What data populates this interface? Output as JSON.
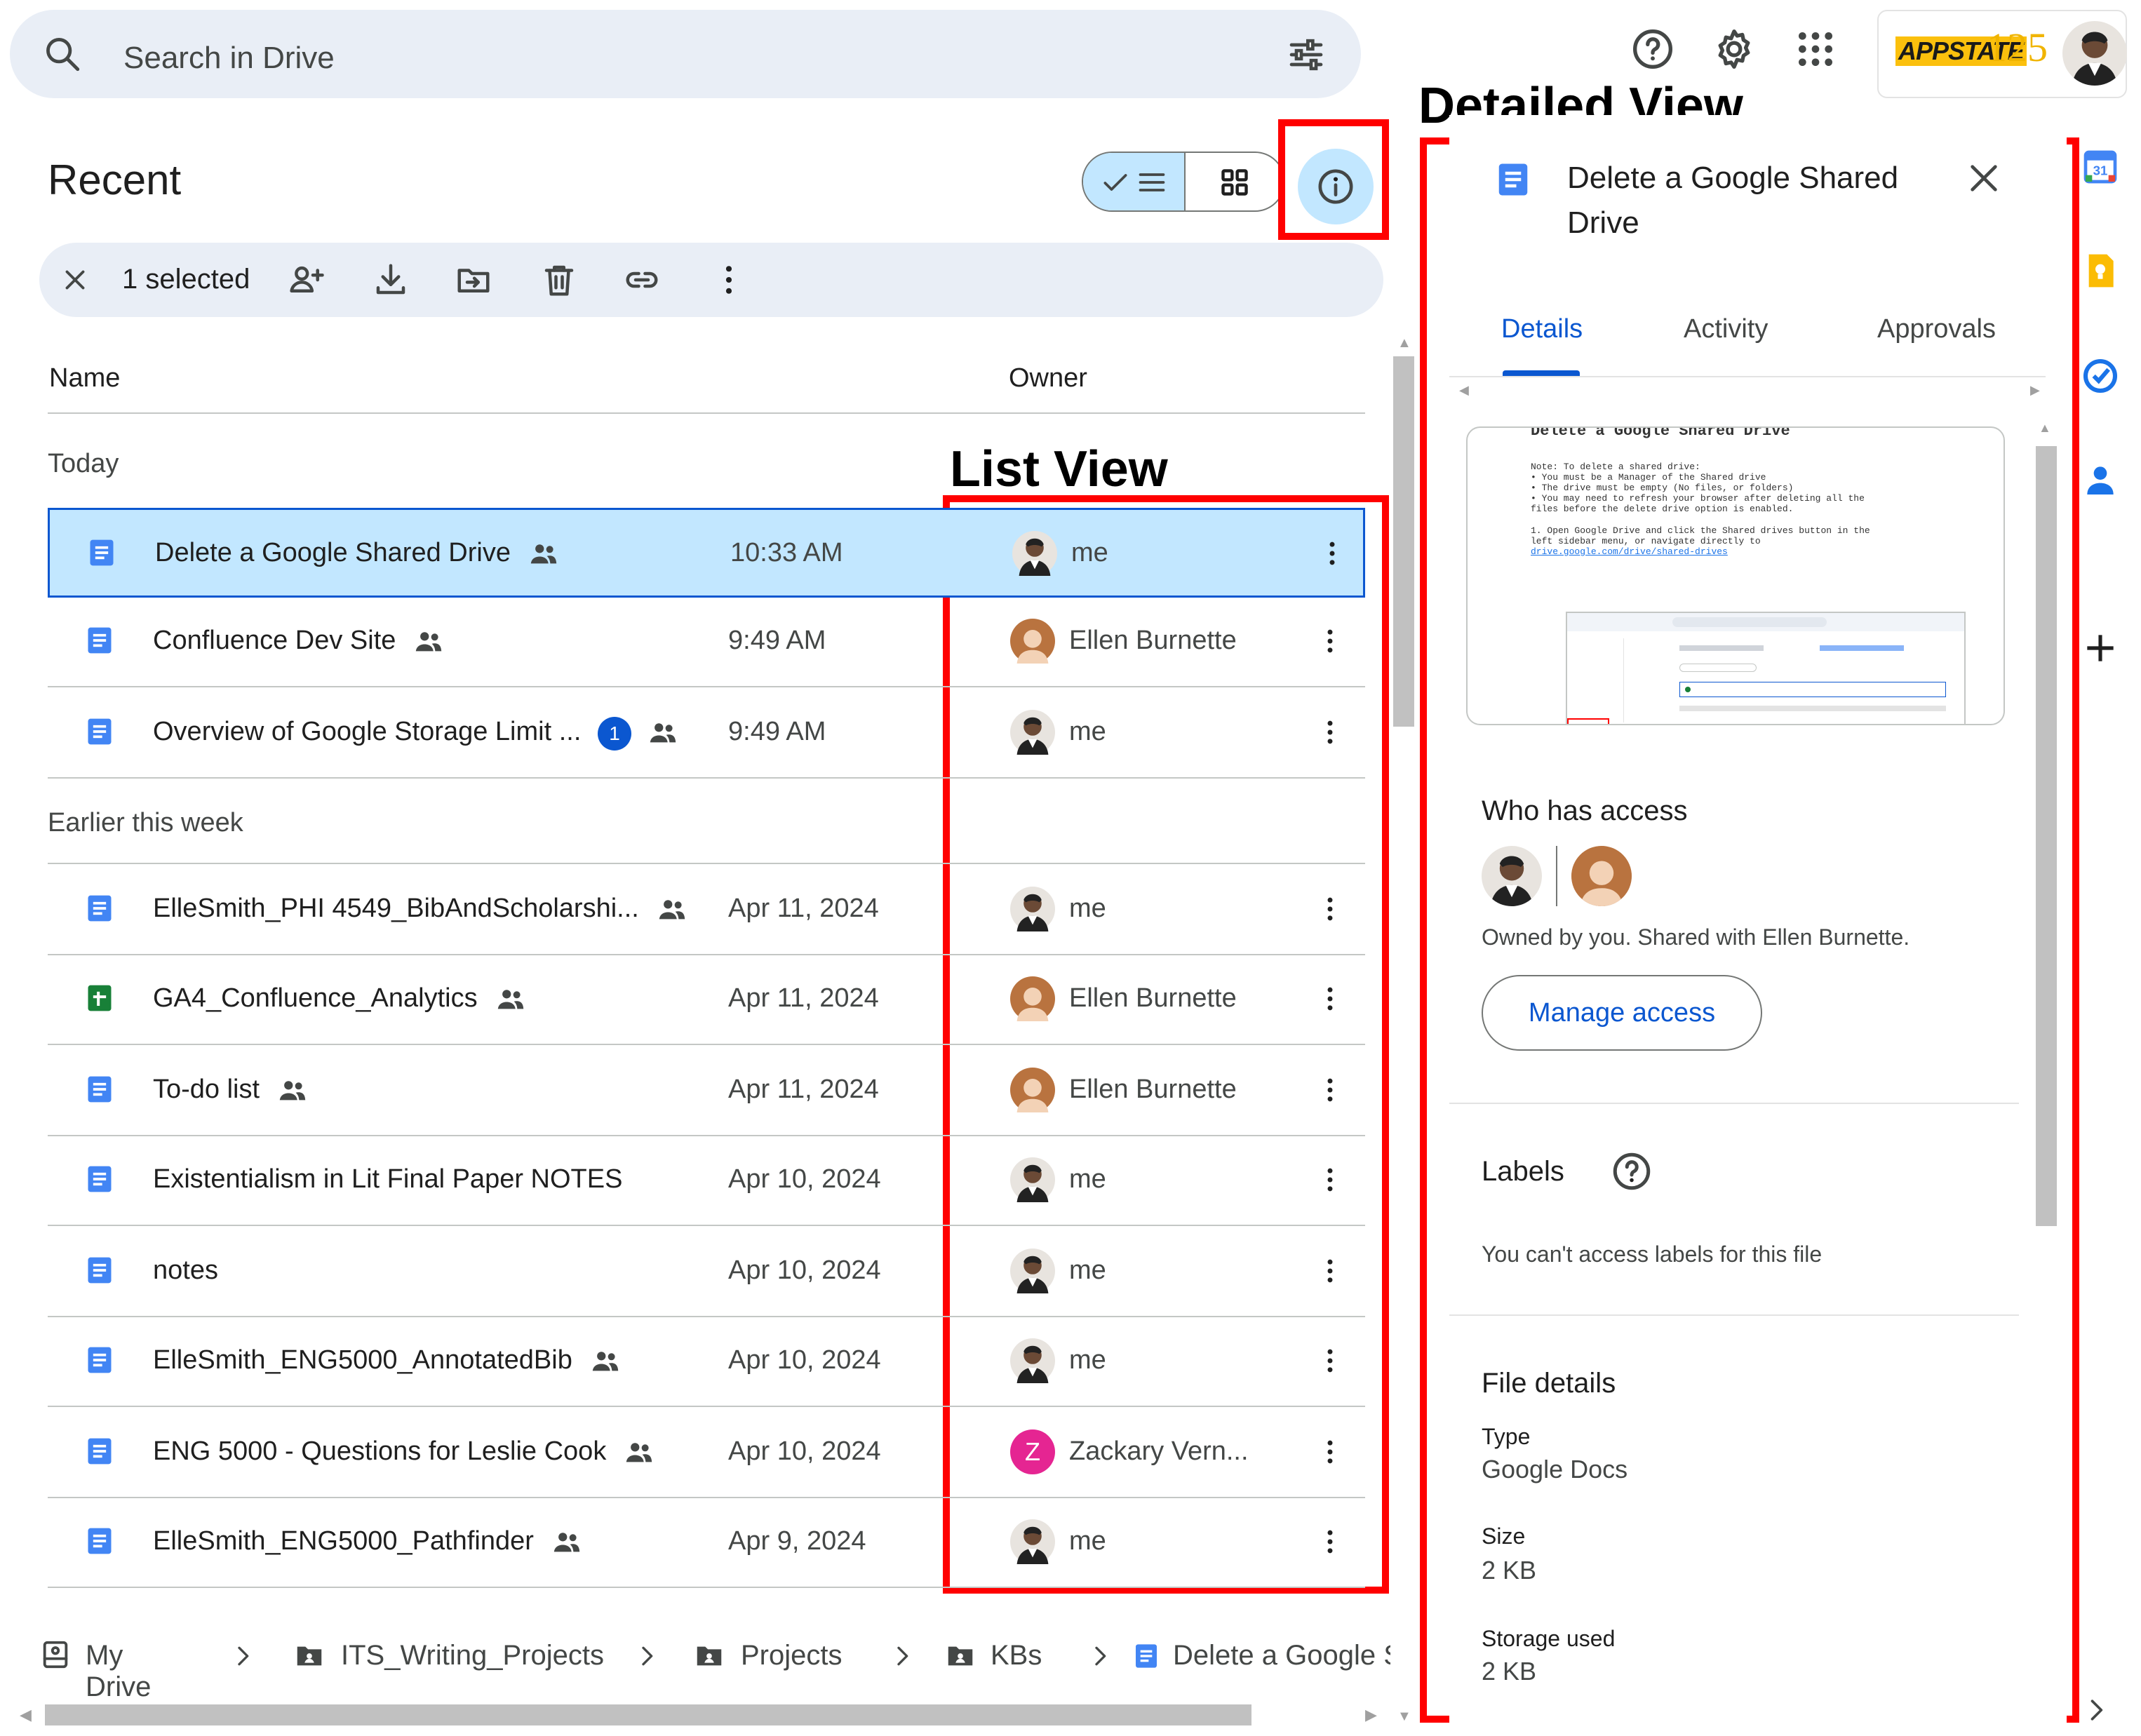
{
  "search": {
    "placeholder": "Search in Drive"
  },
  "brand": {
    "prefix": "APPSTATE",
    "number": "125"
  },
  "view": {
    "title": "Recent"
  },
  "selection": {
    "label": "1 selected"
  },
  "columns": {
    "name": "Name",
    "owner": "Owner"
  },
  "annotations": {
    "detailed": "Detailed View",
    "list": "List View"
  },
  "sections": {
    "today": "Today",
    "earlier": "Earlier this week"
  },
  "files": [
    {
      "name": "Delete a Google Shared Drive",
      "date": "10:33 AM",
      "owner": "me",
      "type": "doc",
      "shared": true,
      "selected": true
    },
    {
      "name": "Confluence Dev Site",
      "date": "9:49 AM",
      "owner": "Ellen Burnette",
      "type": "doc",
      "shared": true
    },
    {
      "name": "Overview of Google Storage Limit ...",
      "date": "9:49 AM",
      "owner": "me",
      "type": "doc",
      "shared": true,
      "badge": "1"
    },
    {
      "name": "ElleSmith_PHI 4549_BibAndScholarshi...",
      "date": "Apr 11, 2024",
      "owner": "me",
      "type": "doc",
      "shared": true
    },
    {
      "name": "GA4_Confluence_Analytics",
      "date": "Apr 11, 2024",
      "owner": "Ellen Burnette",
      "type": "sheet",
      "shared": true
    },
    {
      "name": "To-do list",
      "date": "Apr 11, 2024",
      "owner": "Ellen Burnette",
      "type": "doc",
      "shared": true
    },
    {
      "name": "Existentialism in Lit Final Paper NOTES",
      "date": "Apr 10, 2024",
      "owner": "me",
      "type": "doc",
      "shared": false
    },
    {
      "name": "notes",
      "date": "Apr 10, 2024",
      "owner": "me",
      "type": "doc",
      "shared": false
    },
    {
      "name": "ElleSmith_ENG5000_AnnotatedBib",
      "date": "Apr 10, 2024",
      "owner": "me",
      "type": "doc",
      "shared": true
    },
    {
      "name": "ENG 5000 - Questions for Leslie Cook",
      "date": "Apr 10, 2024",
      "owner": "Zackary Vern...",
      "type": "doc",
      "shared": true,
      "owner_initial": "Z"
    },
    {
      "name": "ElleSmith_ENG5000_Pathfinder",
      "date": "Apr 9, 2024",
      "owner": "me",
      "type": "doc",
      "shared": true
    }
  ],
  "breadcrumb": [
    "My Drive",
    "ITS_Writing_Projects",
    "Projects",
    "KBs",
    "Delete a Google S"
  ],
  "details": {
    "title": "Delete a Google Shared Drive",
    "tabs": [
      "Details",
      "Activity",
      "Approvals"
    ],
    "preview": {
      "heading": "Delete a Google Shared Drive",
      "lines": [
        "Note: To delete a shared drive:",
        "  • You must be a Manager of the Shared drive",
        "  • The drive must be empty (No files, or folders)",
        "  • You may need to refresh your browser after deleting all the",
        "    files before the delete drive option is enabled.",
        "",
        "  1. Open Google Drive and click the Shared drives button in the",
        "     left sidebar menu, or navigate directly to",
        "     drive.google.com/drive/shared-drives"
      ]
    },
    "who_has_access": "Who has access",
    "access_text": "Owned by you. Shared with Ellen Burnette.",
    "manage_access": "Manage access",
    "labels_title": "Labels",
    "labels_text": "You can't access labels for this file",
    "file_details_title": "File details",
    "type_label": "Type",
    "type_value": "Google Docs",
    "size_label": "Size",
    "size_value": "2 KB",
    "storage_label": "Storage used",
    "storage_value": "2 KB"
  },
  "colors": {
    "accent": "#0b57d0",
    "selected_bg": "#c2e7ff",
    "annotation_red": "#ff0000",
    "doc_blue": "#4285f4",
    "sheet_green": "#188038",
    "owner_z": "#e52592"
  }
}
